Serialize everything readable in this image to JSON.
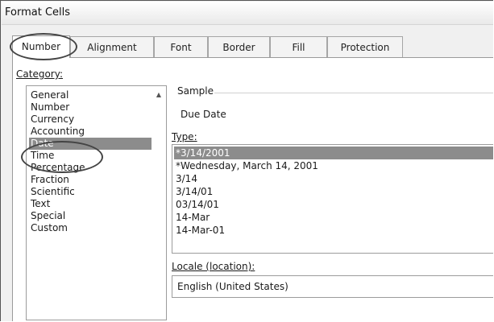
{
  "window": {
    "title": "Format Cells"
  },
  "tabs": [
    {
      "label": "Number",
      "active": true
    },
    {
      "label": "Alignment"
    },
    {
      "label": "Font"
    },
    {
      "label": "Border"
    },
    {
      "label": "Fill"
    },
    {
      "label": "Protection"
    }
  ],
  "category": {
    "label": "Category:",
    "items": [
      "General",
      "Number",
      "Currency",
      "Accounting",
      "Date",
      "Time",
      "Percentage",
      "Fraction",
      "Scientific",
      "Text",
      "Special",
      "Custom"
    ],
    "selected": "Date"
  },
  "sample": {
    "label": "Sample",
    "value": "Due Date"
  },
  "type": {
    "label": "Type:",
    "items": [
      "*3/14/2001",
      "*Wednesday, March 14, 2001",
      "3/14",
      "3/14/01",
      "03/14/01",
      "14-Mar",
      "14-Mar-01"
    ],
    "selected": "*3/14/2001"
  },
  "locale": {
    "label": "Locale (location):",
    "value": "English (United States)"
  },
  "colors": {
    "selection": "#8c8c8c",
    "panel": "#ffffff",
    "chrome": "#f0f0f0"
  }
}
